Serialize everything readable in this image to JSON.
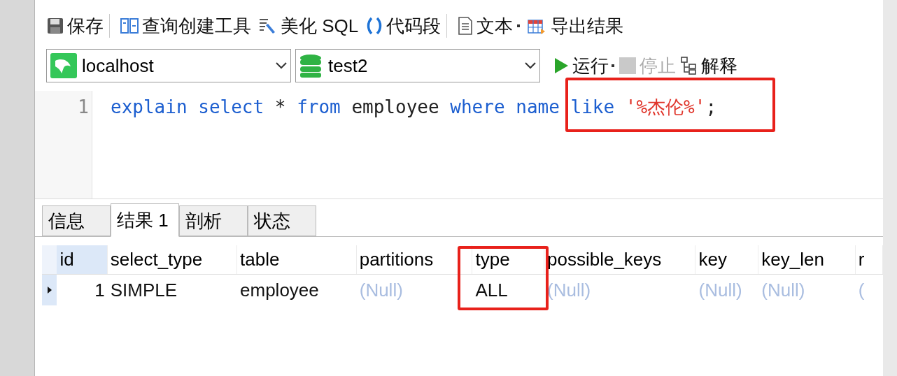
{
  "toolbar": [
    {
      "kind": "save",
      "label": "保存"
    },
    {
      "kind": "builder",
      "label": "查询创建工具"
    },
    {
      "kind": "beautify",
      "label": "美化 SQL"
    },
    {
      "kind": "snippet",
      "label": "代码段"
    },
    {
      "kind": "text",
      "label": "文本",
      "dropdown": true
    },
    {
      "kind": "export",
      "label": "导出结果"
    }
  ],
  "connection": {
    "value": "localhost"
  },
  "database": {
    "value": "test2"
  },
  "actions": [
    {
      "kind": "run",
      "label": "运行",
      "dropdown": true,
      "disabled": false
    },
    {
      "kind": "stop",
      "label": "停止",
      "dropdown": false,
      "disabled": true
    },
    {
      "kind": "explain",
      "label": "解释",
      "dropdown": false,
      "disabled": false
    }
  ],
  "editor": {
    "lines": [
      {
        "number": "1",
        "tokens": [
          {
            "kind": "keyword",
            "text": "explain"
          },
          {
            "kind": "keyword",
            "text": "select"
          },
          {
            "kind": "plain",
            "text": "*"
          },
          {
            "kind": "keyword",
            "text": "from"
          },
          {
            "kind": "plain",
            "text": "employee"
          },
          {
            "kind": "keyword",
            "text": "where"
          },
          {
            "kind": "keyword",
            "text": "name"
          },
          {
            "kind": "keyword",
            "text": "like"
          },
          {
            "kind": "string",
            "text": "'%杰伦%'",
            "semicolon": ";"
          }
        ]
      }
    ]
  },
  "tabs": [
    {
      "label": "信息",
      "selected": false
    },
    {
      "label": "结果 1",
      "selected": true
    },
    {
      "label": "剖析",
      "selected": false
    },
    {
      "label": "状态",
      "selected": false
    }
  ],
  "table": {
    "columns": [
      "id",
      "select_type",
      "table",
      "partitions",
      "type",
      "possible_keys",
      "key",
      "key_len",
      "r"
    ],
    "rows": [
      {
        "selected": true,
        "cells": [
          {
            "text": "1",
            "null": false
          },
          {
            "text": "SIMPLE",
            "null": false
          },
          {
            "text": "employee",
            "null": false
          },
          {
            "text": "(Null)",
            "null": true
          },
          {
            "text": "ALL",
            "null": false
          },
          {
            "text": "(Null)",
            "null": true
          },
          {
            "text": "(Null)",
            "null": true
          },
          {
            "text": "(Null)",
            "null": true
          },
          {
            "text": "(",
            "null": true
          }
        ]
      }
    ]
  }
}
